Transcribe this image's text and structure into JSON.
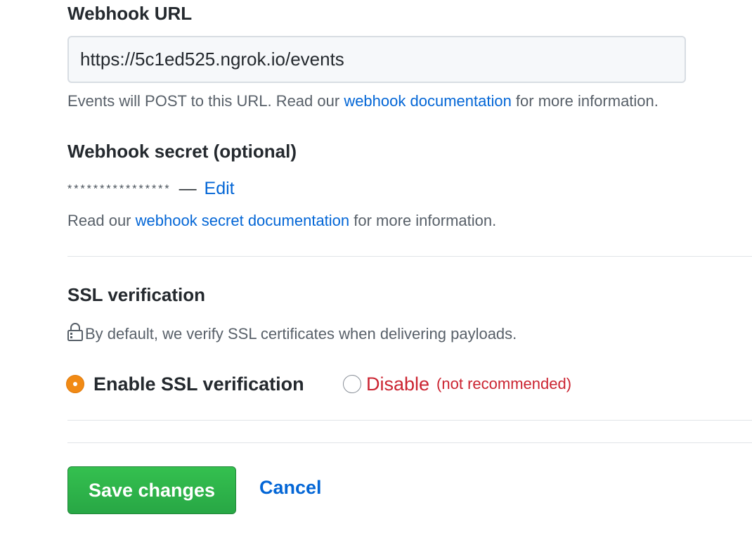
{
  "webhook_url": {
    "label": "Webhook URL",
    "value": "https://5c1ed525.ngrok.io/events",
    "note_prefix": "Events will POST to this URL. Read our ",
    "note_link": "webhook documentation",
    "note_suffix": " for more information."
  },
  "webhook_secret": {
    "label": "Webhook secret (optional)",
    "masked_value": "****************",
    "separator": "—",
    "edit_link": "Edit",
    "note_prefix": "Read our ",
    "note_link": "webhook secret documentation",
    "note_suffix": " for more information."
  },
  "ssl": {
    "label": "SSL verification",
    "description": "By default, we verify SSL certificates when delivering payloads.",
    "icon": "lock-icon",
    "options": [
      {
        "label": "Enable SSL verification",
        "checked": true
      },
      {
        "label": "Disable",
        "note": "(not recommended)",
        "checked": false
      }
    ],
    "accent_color": "#f18a14",
    "danger_color": "#cb2431"
  },
  "actions": {
    "save_label": "Save changes",
    "cancel_label": "Cancel",
    "save_color": "#28a745",
    "link_color": "#0366d6"
  }
}
